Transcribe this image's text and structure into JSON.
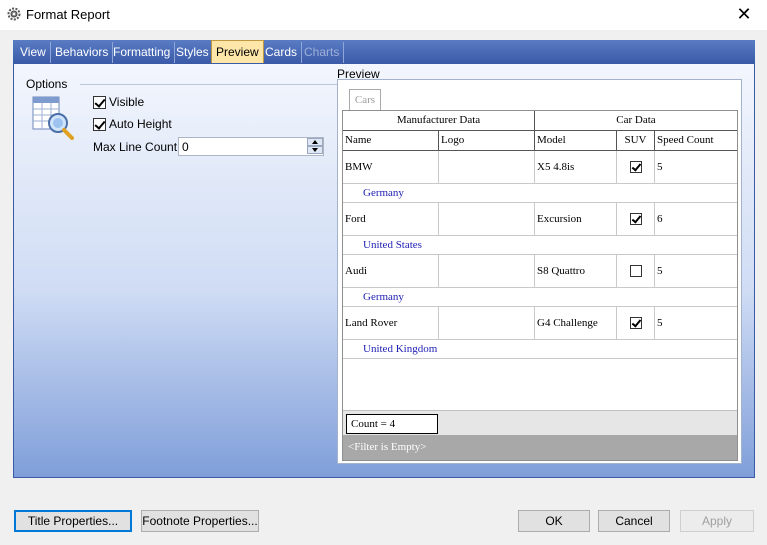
{
  "window": {
    "title": "Format Report",
    "close_glyph": "✕"
  },
  "tabs": [
    {
      "label": "View",
      "active": false
    },
    {
      "label": "Behaviors",
      "active": false
    },
    {
      "label": "Formatting",
      "active": false
    },
    {
      "label": "Styles",
      "active": false
    },
    {
      "label": "Preview",
      "active": true
    },
    {
      "label": "Cards",
      "active": false
    },
    {
      "label": "Charts",
      "active": false
    }
  ],
  "options": {
    "title": "Options",
    "visible": {
      "label": "Visible",
      "checked": true
    },
    "auto_height": {
      "label": "Auto Height",
      "checked": true
    },
    "max_line_count": {
      "label": "Max Line Count:",
      "value": "0"
    }
  },
  "preview": {
    "title": "Preview",
    "grid_tab": "Cars",
    "band_headers": [
      "Manufacturer Data",
      "Car Data"
    ],
    "columns": [
      "Name",
      "Logo",
      "Model",
      "SUV",
      "Speed Count"
    ],
    "rows": [
      {
        "name": "BMW",
        "logo": "",
        "model": "X5 4.8is",
        "suv": true,
        "speed_count": "5",
        "country": "Germany"
      },
      {
        "name": "Ford",
        "logo": "",
        "model": "Excursion",
        "suv": true,
        "speed_count": "6",
        "country": "United States"
      },
      {
        "name": "Audi",
        "logo": "",
        "model": "S8 Quattro",
        "suv": false,
        "speed_count": "5",
        "country": "Germany"
      },
      {
        "name": "Land Rover",
        "logo": "",
        "model": "G4 Challenge",
        "suv": true,
        "speed_count": "5",
        "country": "United Kingdom"
      }
    ],
    "summary": "Count = 4",
    "filter": "<Filter is Empty>"
  },
  "buttons": {
    "title_properties": "Title Properties...",
    "footnote_properties": "Footnote Properties...",
    "ok": "OK",
    "cancel": "Cancel",
    "apply": "Apply"
  },
  "colors": {
    "tab_strip": "#3b5aa8",
    "active_tab": "#fde6a8",
    "country_text": "#1f1fb4",
    "filter_bar": "#a8a8a8",
    "default_button_border": "#0078d7"
  }
}
